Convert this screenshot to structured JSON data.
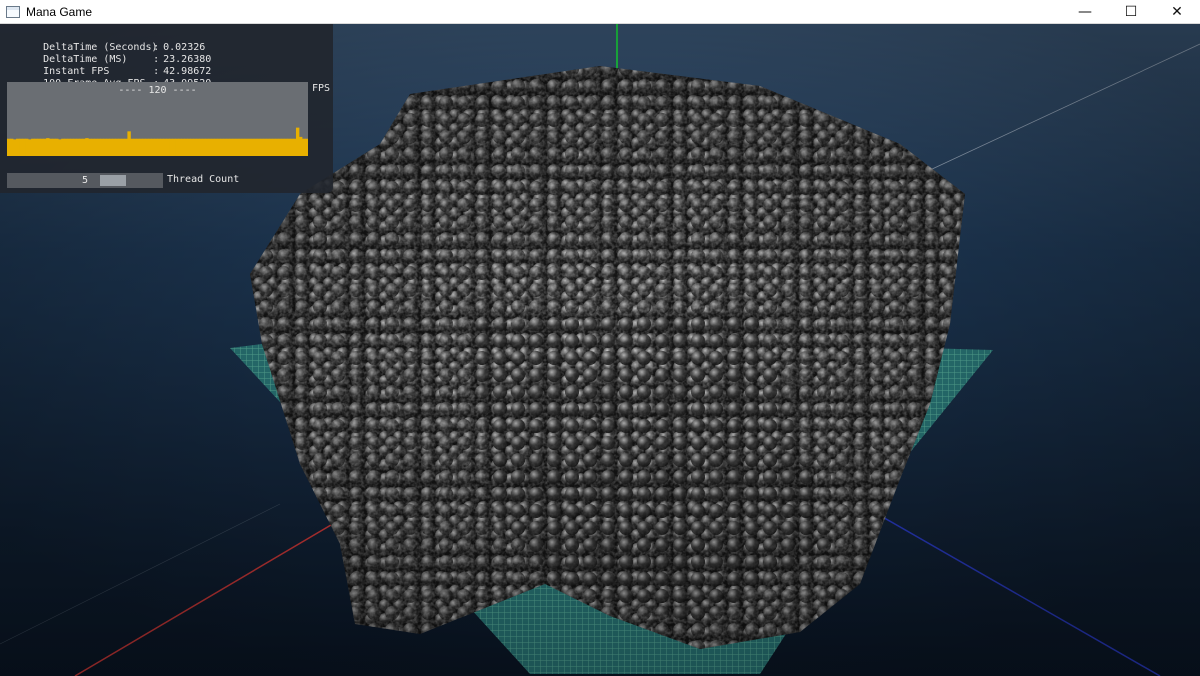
{
  "window": {
    "title": "Mana Game",
    "controls": {
      "minimize": "—",
      "maximize": "☐",
      "close": "✕"
    }
  },
  "stats": [
    {
      "label": "DeltaTime (Seconds)",
      "sep": ":",
      "value": "0.02326"
    },
    {
      "label": "DeltaTime (MS)",
      "sep": ":",
      "value": "23.26380"
    },
    {
      "label": "Instant FPS",
      "sep": ":",
      "value": "42.98672"
    },
    {
      "label": "100 Frame Avg FPS",
      "sep": ":",
      "value": "43.09520"
    }
  ],
  "fps_graph": {
    "label": "FPS",
    "overlay_text": "---- 120 ----",
    "max": 120,
    "bar_color": "#e8b000",
    "values": [
      28,
      28,
      27,
      28,
      28,
      28,
      28,
      27,
      28,
      28,
      28,
      28,
      28,
      29,
      28,
      28,
      28,
      27,
      28,
      28,
      28,
      28,
      28,
      28,
      28,
      28,
      29,
      28,
      28,
      28,
      28,
      28,
      28,
      28,
      28,
      28,
      28,
      28,
      28,
      28,
      40,
      28,
      28,
      28,
      28,
      28,
      28,
      28,
      28,
      28,
      28,
      28,
      28,
      28,
      28,
      28,
      28,
      28,
      28,
      28,
      28,
      28,
      28,
      28,
      28,
      28,
      28,
      28,
      28,
      28,
      28,
      28,
      28,
      28,
      28,
      28,
      28,
      28,
      28,
      28,
      28,
      28,
      28,
      28,
      28,
      28,
      28,
      28,
      28,
      28,
      28,
      28,
      28,
      28,
      28,
      28,
      46,
      31,
      28,
      28
    ]
  },
  "thread_slider": {
    "label": "Thread Count",
    "value": "5",
    "fraction": 0.72
  },
  "colors": {
    "hud_background": "#21262e",
    "graph_background": "#6a6e73",
    "accent": "#e8b000",
    "axis_green": "#1fd34a",
    "axis_red": "#d23a3a",
    "axis_blue": "#2a3cc8",
    "grid_plane": "#2f8f8a"
  }
}
